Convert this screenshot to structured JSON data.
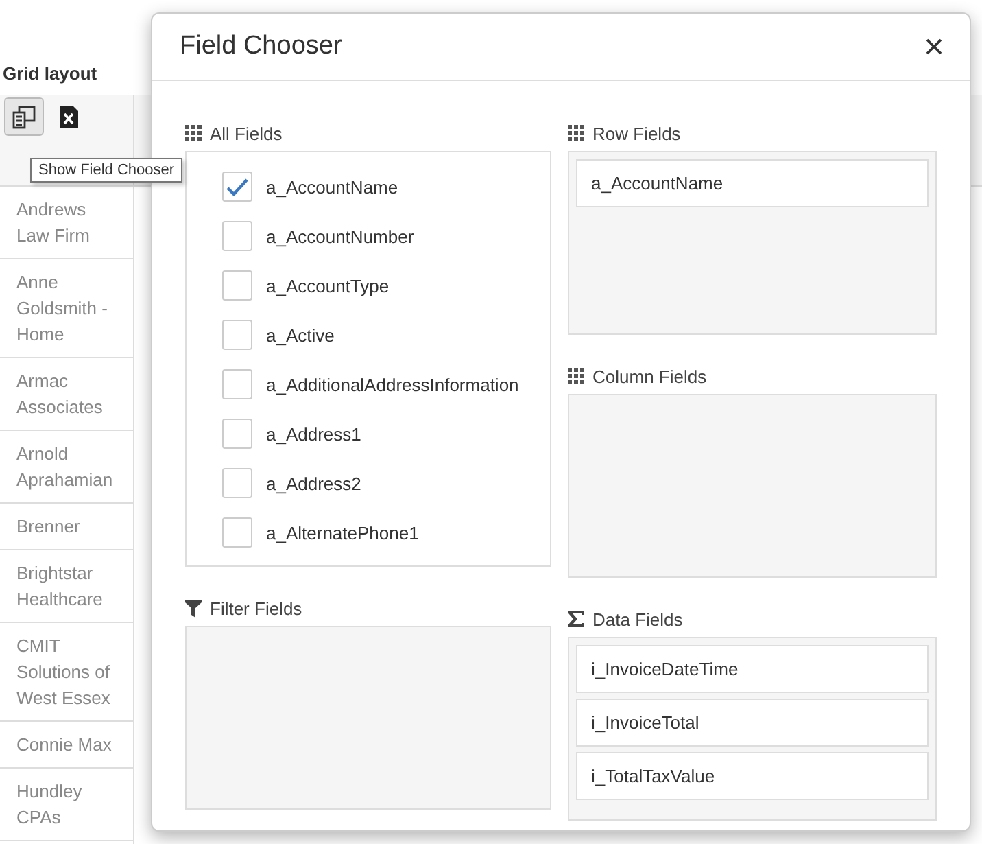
{
  "page": {
    "title": "Grid layout",
    "toolbar": [
      {
        "kind": "field-chooser",
        "selected": true
      },
      {
        "kind": "excel",
        "selected": false
      }
    ],
    "tooltip": "Show Field Chooser",
    "rows": [
      "Andrews Law Firm",
      "Anne Goldsmith - Home",
      "Armac Associates",
      "Arnold Aprahamian",
      "Brenner",
      "Brightstar Healthcare",
      "CMIT Solutions of West Essex",
      "Connie Max",
      "Hundley CPAs"
    ]
  },
  "dialog": {
    "title": "Field Chooser",
    "all_fields": {
      "label": "All Fields",
      "kind": "grid",
      "items": [
        {
          "name": "a_AccountName",
          "checked": true
        },
        {
          "name": "a_AccountNumber",
          "checked": false
        },
        {
          "name": "a_AccountType",
          "checked": false
        },
        {
          "name": "a_Active",
          "checked": false
        },
        {
          "name": "a_AdditionalAddressInformation",
          "checked": false
        },
        {
          "name": "a_Address1",
          "checked": false
        },
        {
          "name": "a_Address2",
          "checked": false
        },
        {
          "name": "a_AlternatePhone1",
          "checked": false
        }
      ]
    },
    "areas": [
      {
        "label": "Row Fields",
        "kind": "grid",
        "items": [
          "a_AccountName"
        ]
      },
      {
        "label": "Column Fields",
        "kind": "grid"
      },
      {
        "label": "Filter Fields",
        "kind": "filter"
      },
      {
        "label": "Data Fields",
        "kind": "sum",
        "items": [
          "i_InvoiceDateTime",
          "i_InvoiceTotal",
          "i_TotalTaxValue"
        ]
      }
    ]
  }
}
